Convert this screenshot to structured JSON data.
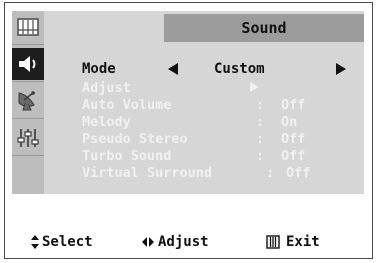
{
  "menu": {
    "title": "Sound",
    "mode": {
      "label": "Mode",
      "value": "Custom"
    },
    "items": [
      {
        "label": "Adjust",
        "value": ""
      },
      {
        "label": "Auto Volume",
        "value": "Off"
      },
      {
        "label": "Melody",
        "value": "On"
      },
      {
        "label": "Pseudo Stereo",
        "value": "Off"
      },
      {
        "label": "Turbo Sound",
        "value": "Off"
      },
      {
        "label": "Virtual Surround",
        "value": "Off"
      }
    ]
  },
  "sidebar": {
    "icons": [
      "picture-icon",
      "speaker-icon",
      "satellite-dish-icon",
      "equalizer-settings-icon"
    ]
  },
  "footer": {
    "select": "Select",
    "adjust": "Adjust",
    "exit": "Exit"
  },
  "colors": {
    "menu_bg": "#d6d6d6",
    "sidebar_bg": "#bdbdbd",
    "title_bar_bg": "#9c9c9c",
    "active_icon_bg": "#1d1d1d",
    "inactive_text": "#f1f1f1",
    "active_text": "#111111"
  }
}
